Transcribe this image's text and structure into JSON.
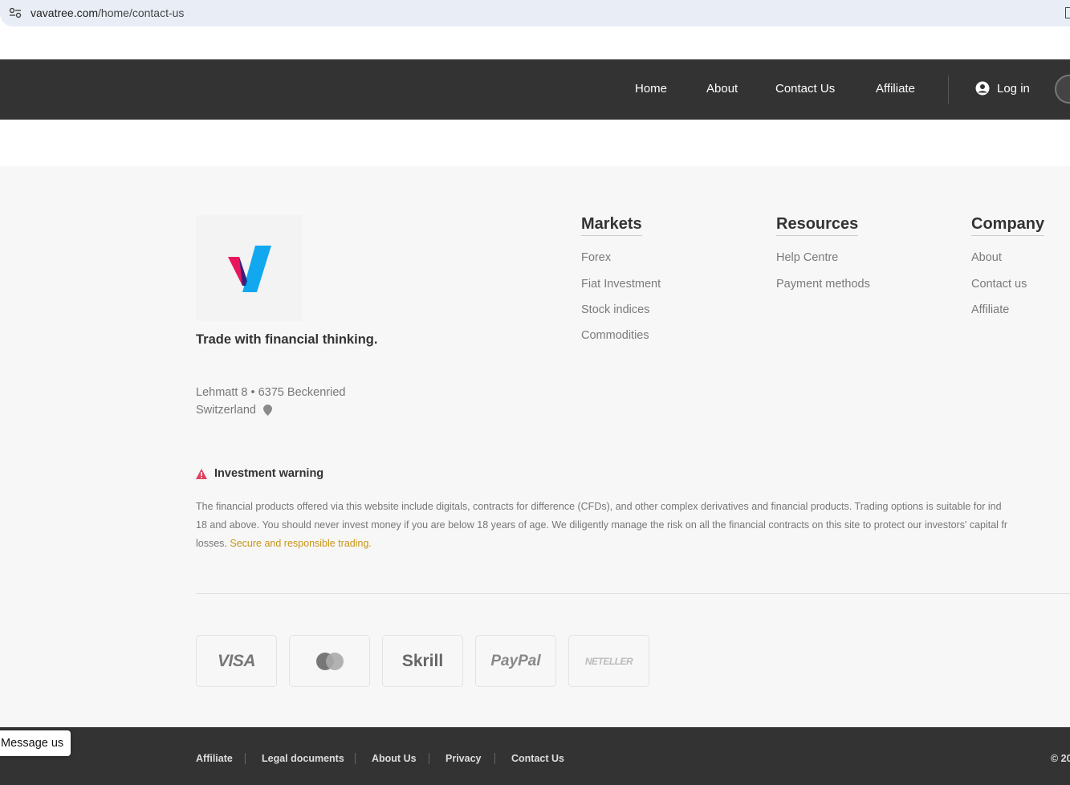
{
  "browser": {
    "url_host": "vavatree.com",
    "url_path": "/home/contact-us"
  },
  "nav": {
    "items": [
      "Home",
      "About",
      "Contact Us",
      "Affiliate"
    ],
    "login_label": "Log in"
  },
  "footer": {
    "tagline": "Trade with financial thinking.",
    "address_line1": "Lehmatt 8 • 6375 Beckenried",
    "address_line2": "Switzerland",
    "columns": [
      {
        "title": "Markets",
        "links": [
          "Forex",
          "Fiat Investment",
          "Stock indices",
          "Commodities"
        ]
      },
      {
        "title": "Resources",
        "links": [
          "Help Centre",
          "Payment methods"
        ]
      },
      {
        "title": "Company",
        "links": [
          "About",
          "Contact us",
          "Affiliate"
        ]
      }
    ],
    "warning_title": "Investment warning",
    "warning_line1": "The financial products offered via this website include digitals, contracts for difference (CFDs), and other complex derivatives and financial products. Trading options is suitable for ind",
    "warning_line2": "18 and above. You should never invest money if you are below 18 years of age. We diligently manage the risk on all the financial contracts on this site to protect our investors' capital fr",
    "warning_line3_prefix": "losses. ",
    "warning_link": "Secure and responsible trading.",
    "payments": [
      "VISA",
      "mastercard",
      "Skrill",
      "PayPal",
      "NETELLER"
    ]
  },
  "bottom_bar": {
    "links": [
      "Affiliate",
      "Legal documents",
      "About Us",
      "Privacy",
      "Contact Us"
    ],
    "copyright": "© 20"
  },
  "chat": {
    "label": "Message us"
  },
  "colors": {
    "navbar": "#333333",
    "logo_pink": "#e8175d",
    "logo_blue": "#12a8f0",
    "warning_red": "#e0405e",
    "link_gold": "#c79516"
  }
}
